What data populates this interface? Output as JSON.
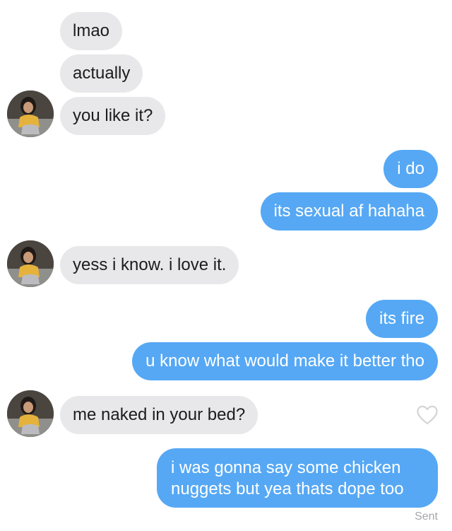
{
  "messages": [
    {
      "side": "received",
      "text": "lmao"
    },
    {
      "side": "received",
      "text": "actually"
    },
    {
      "side": "received",
      "text": "you like it?"
    },
    {
      "side": "sent",
      "text": "i do"
    },
    {
      "side": "sent",
      "text": "its sexual af hahaha"
    },
    {
      "side": "received",
      "text": "yess i know. i love it."
    },
    {
      "side": "sent",
      "text": "its fire"
    },
    {
      "side": "sent",
      "text": "u know what would make it better tho"
    },
    {
      "side": "received",
      "text": "me naked in your bed?"
    },
    {
      "side": "sent",
      "text": "i was gonna say some chicken nuggets but yea thats dope too"
    }
  ],
  "status": "Sent",
  "icons": {
    "avatar": "contact-avatar",
    "reaction": "heart-outline-icon"
  },
  "colors": {
    "sent_bubble": "#56a8f4",
    "received_bubble": "#e8e8ea",
    "received_text": "#1c1c1e",
    "sent_text": "#ffffff",
    "status_text": "#a7a7ab"
  }
}
